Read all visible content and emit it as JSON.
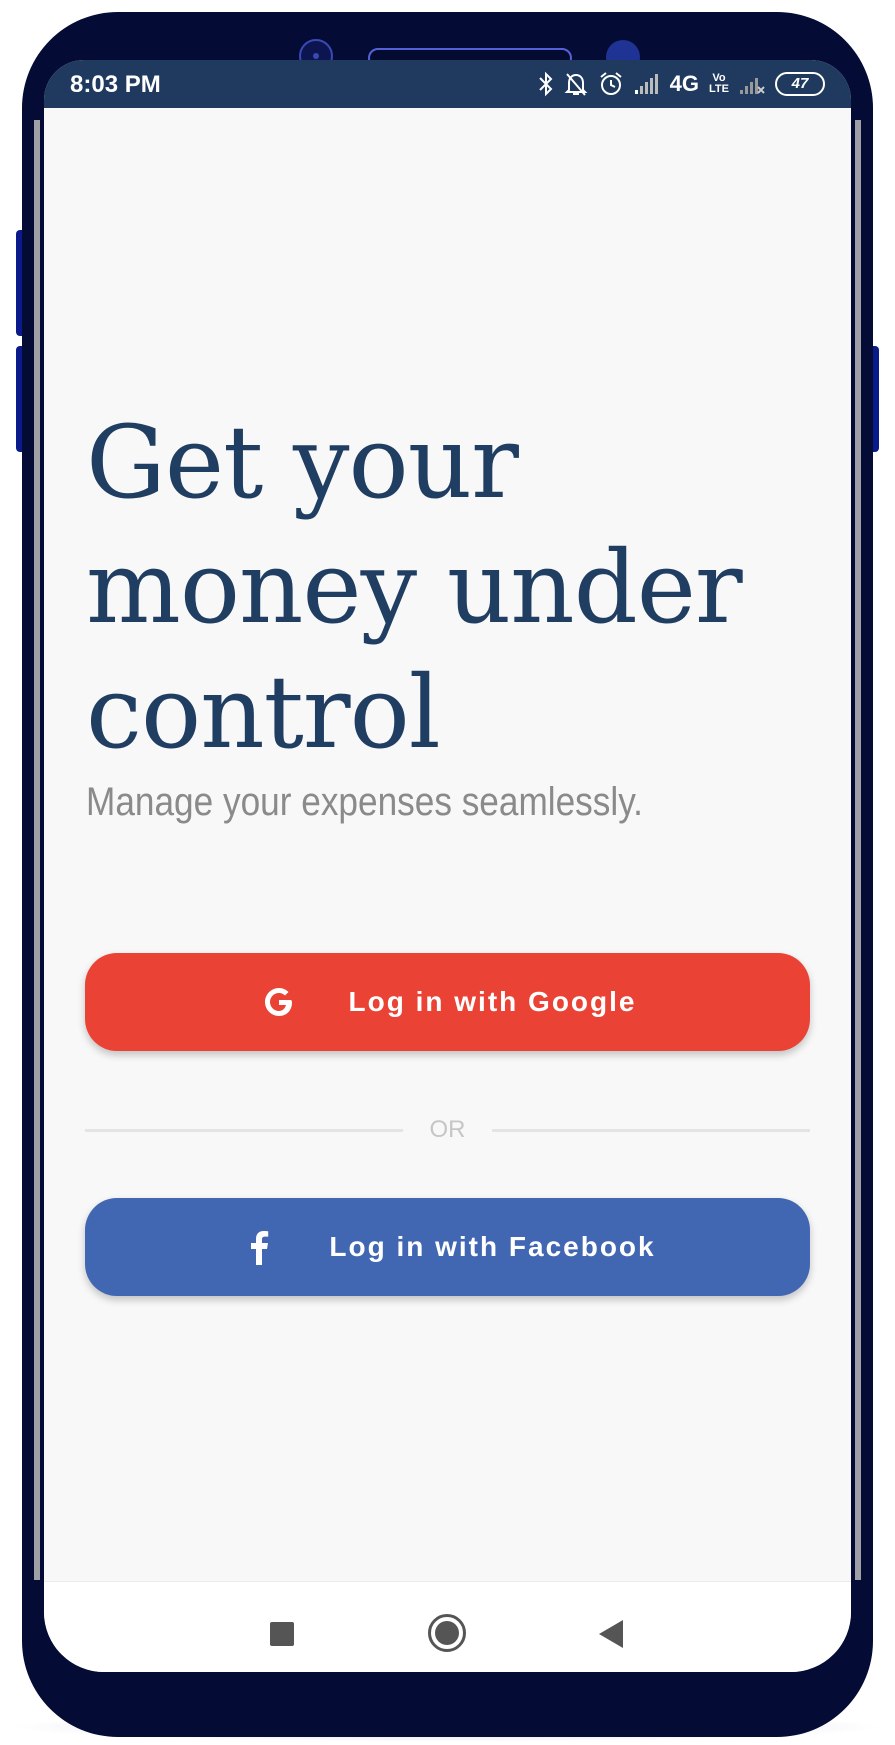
{
  "status_bar": {
    "time": "8:03 PM",
    "network": "4G",
    "volte_top": "Vo",
    "volte_bottom": "LTE",
    "battery": "47",
    "icons": [
      "bluetooth-icon",
      "notifications-off-icon",
      "alarm-icon",
      "signal-icon",
      "signal-empty-icon"
    ]
  },
  "hero": {
    "title": "Get your money under control",
    "subtitle": "Manage your expenses seamlessly."
  },
  "actions": {
    "google_label": "Log in with Google",
    "google_icon": "google-icon",
    "divider_text": "OR",
    "facebook_label": "Log in with Facebook",
    "facebook_icon": "facebook-icon"
  },
  "colors": {
    "title": "#203e62",
    "status_bar": "#1f3a5e",
    "google": "#ea4335",
    "facebook": "#4267b2",
    "frame": "#040c36"
  },
  "nav_bar": {
    "icons": [
      "recents-icon",
      "home-icon",
      "back-icon"
    ]
  }
}
